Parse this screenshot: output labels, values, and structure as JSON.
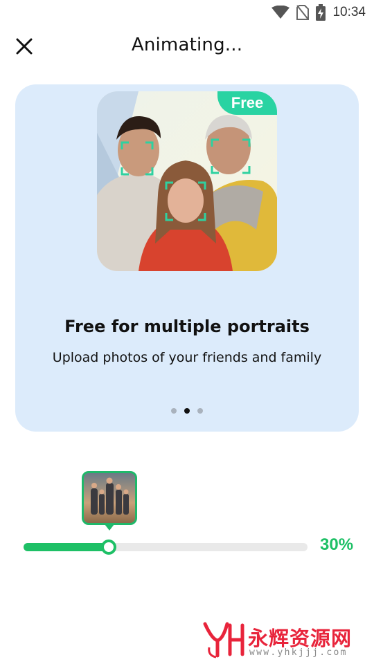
{
  "status_bar": {
    "time": "10:34",
    "icons": [
      "wifi-icon",
      "no-sim-icon",
      "battery-charging-icon"
    ]
  },
  "header": {
    "title": "Animating...",
    "close_icon": "close-icon"
  },
  "card": {
    "badge": "Free",
    "title": "Free for multiple portraits",
    "subtitle": "Upload photos of your friends and family",
    "carousel_total": 3,
    "carousel_active_index": 1
  },
  "progress": {
    "value_fraction": 0.3,
    "label": "30%"
  },
  "watermark": {
    "logo_letters": "YH",
    "name": "永辉资源网",
    "url": "www.yhkjjj.com"
  },
  "colors": {
    "accent_green": "#1ec066",
    "card_background": "#dcebfb",
    "badge_teal": "#29d3a2",
    "watermark_red": "#e8243b"
  }
}
